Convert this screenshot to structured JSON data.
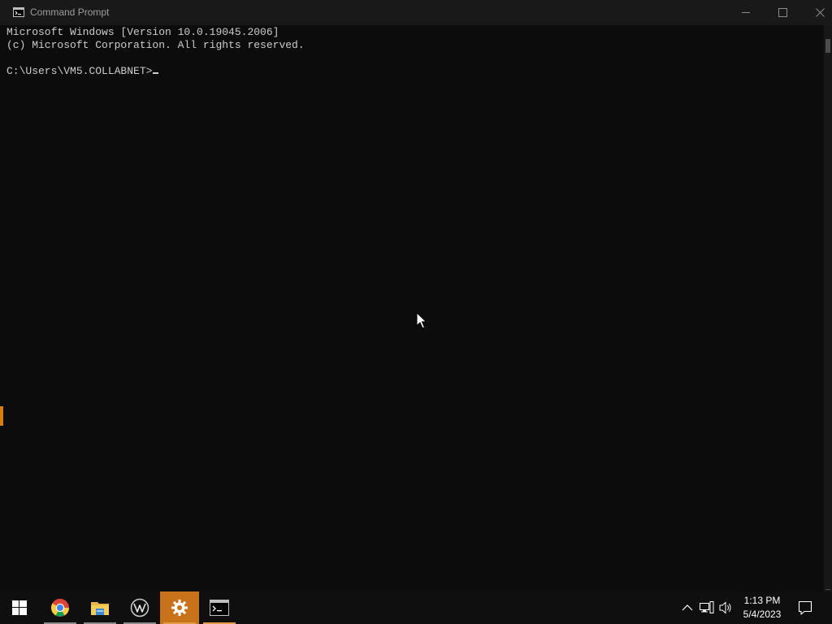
{
  "window": {
    "title": "Command Prompt"
  },
  "console": {
    "lines": [
      "Microsoft Windows [Version 10.0.19045.2006]",
      "(c) Microsoft Corporation. All rights reserved."
    ],
    "prompt": "C:\\Users\\VM5.COLLABNET>"
  },
  "taskbar": {
    "apps": [
      {
        "name": "Start",
        "icon": "windows-logo-icon"
      },
      {
        "name": "Google Chrome",
        "icon": "chrome-icon"
      },
      {
        "name": "File Explorer",
        "icon": "folder-icon"
      },
      {
        "name": "Wireshark",
        "icon": "wireshark-icon"
      },
      {
        "name": "Settings",
        "icon": "gear-icon"
      },
      {
        "name": "Command Prompt",
        "icon": "cmd-icon"
      }
    ],
    "clock": {
      "time": "1:13 PM",
      "date": "5/4/2023"
    }
  },
  "colors": {
    "console_bg": "#0c0c0c",
    "console_fg": "#cccccc",
    "titlebar_bg": "#191919",
    "taskbar_bg": "#0f0f0f",
    "settings_active": "#c8731a"
  }
}
